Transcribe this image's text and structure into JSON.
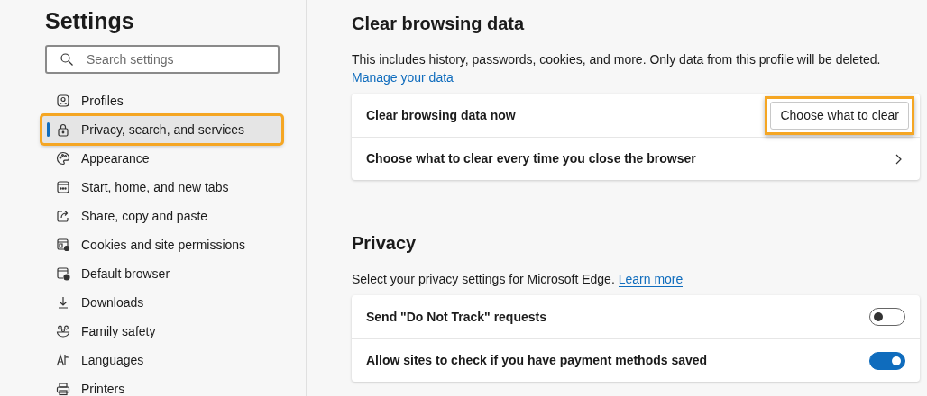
{
  "sidebar": {
    "title": "Settings",
    "search": {
      "placeholder": "Search settings"
    },
    "items": [
      {
        "label": "Profiles",
        "selected": false,
        "highlighted": false
      },
      {
        "label": "Privacy, search, and services",
        "selected": true,
        "highlighted": true
      },
      {
        "label": "Appearance",
        "selected": false,
        "highlighted": false
      },
      {
        "label": "Start, home, and new tabs",
        "selected": false,
        "highlighted": false
      },
      {
        "label": "Share, copy and paste",
        "selected": false,
        "highlighted": false
      },
      {
        "label": "Cookies and site permissions",
        "selected": false,
        "highlighted": false
      },
      {
        "label": "Default browser",
        "selected": false,
        "highlighted": false
      },
      {
        "label": "Downloads",
        "selected": false,
        "highlighted": false
      },
      {
        "label": "Family safety",
        "selected": false,
        "highlighted": false
      },
      {
        "label": "Languages",
        "selected": false,
        "highlighted": false
      },
      {
        "label": "Printers",
        "selected": false,
        "highlighted": false
      }
    ]
  },
  "sections": [
    {
      "title": "Clear browsing data",
      "description": "This includes history, passwords, cookies, and more. Only data from this profile will be deleted.",
      "link": "Manage your data",
      "link_inline": false,
      "rows": [
        {
          "kind": "button",
          "label": "Clear browsing data now",
          "button": "Choose what to clear",
          "highlighted": true
        },
        {
          "kind": "chevron",
          "label": "Choose what to clear every time you close the browser"
        }
      ]
    },
    {
      "title": "Privacy",
      "description": "Select your privacy settings for Microsoft Edge.",
      "link": "Learn more",
      "link_inline": true,
      "rows": [
        {
          "kind": "toggle",
          "label": "Send \"Do Not Track\" requests",
          "on": false
        },
        {
          "kind": "toggle",
          "label": "Allow sites to check if you have payment methods saved",
          "on": true
        }
      ]
    }
  ]
}
